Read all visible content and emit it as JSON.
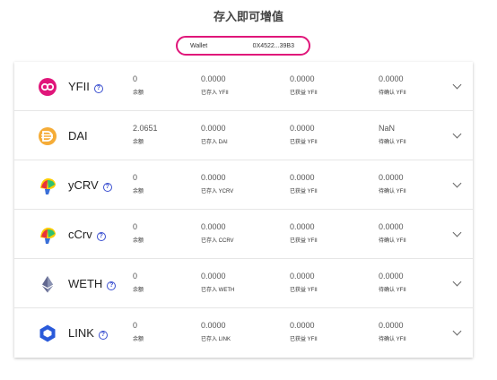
{
  "page": {
    "title": "存入即可增值"
  },
  "wallet": {
    "label": "Wallet",
    "address": "0X4522...39B3"
  },
  "labels": {
    "balance": "余额",
    "deposited_prefix": "已存入",
    "earned": "已获益 YFII",
    "pending": "待确认 YFII"
  },
  "colors": {
    "accent": "#e0167a",
    "help": "#3a4fd0"
  },
  "rows": [
    {
      "name": "YFII",
      "icon": "yfii-icon",
      "has_help": true,
      "balance": "0",
      "deposited": "0.0000",
      "deposited_label": "已存入 YFII",
      "earned": "0.0000",
      "earned_label": "已获益 YFII",
      "pending": "0.0000",
      "pending_label": "待确认 YFII"
    },
    {
      "name": "DAI",
      "icon": "dai-icon",
      "has_help": false,
      "balance": "2.0651",
      "deposited": "0.0000",
      "deposited_label": "已存入 DAI",
      "earned": "0.0000",
      "earned_label": "已获益 YFII",
      "pending": "NaN",
      "pending_label": "待确认 YFII"
    },
    {
      "name": "yCRV",
      "icon": "ycrv-icon",
      "has_help": true,
      "balance": "0",
      "deposited": "0.0000",
      "deposited_label": "已存入 YCRV",
      "earned": "0.0000",
      "earned_label": "已获益 YFII",
      "pending": "0.0000",
      "pending_label": "待确认 YFII"
    },
    {
      "name": "cCrv",
      "icon": "ccrv-icon",
      "has_help": true,
      "balance": "0",
      "deposited": "0.0000",
      "deposited_label": "已存入 CCRV",
      "earned": "0.0000",
      "earned_label": "已获益 YFII",
      "pending": "0.0000",
      "pending_label": "待确认 YFII"
    },
    {
      "name": "WETH",
      "icon": "weth-icon",
      "has_help": true,
      "balance": "0",
      "deposited": "0.0000",
      "deposited_label": "已存入 WETH",
      "earned": "0.0000",
      "earned_label": "已获益 YFII",
      "pending": "0.0000",
      "pending_label": "待确认 YFII"
    },
    {
      "name": "LINK",
      "icon": "link-icon",
      "has_help": true,
      "balance": "0",
      "deposited": "0.0000",
      "deposited_label": "已存入 LINK",
      "earned": "0.0000",
      "earned_label": "已获益 YFII",
      "pending": "0.0000",
      "pending_label": "待确认 YFII"
    }
  ]
}
